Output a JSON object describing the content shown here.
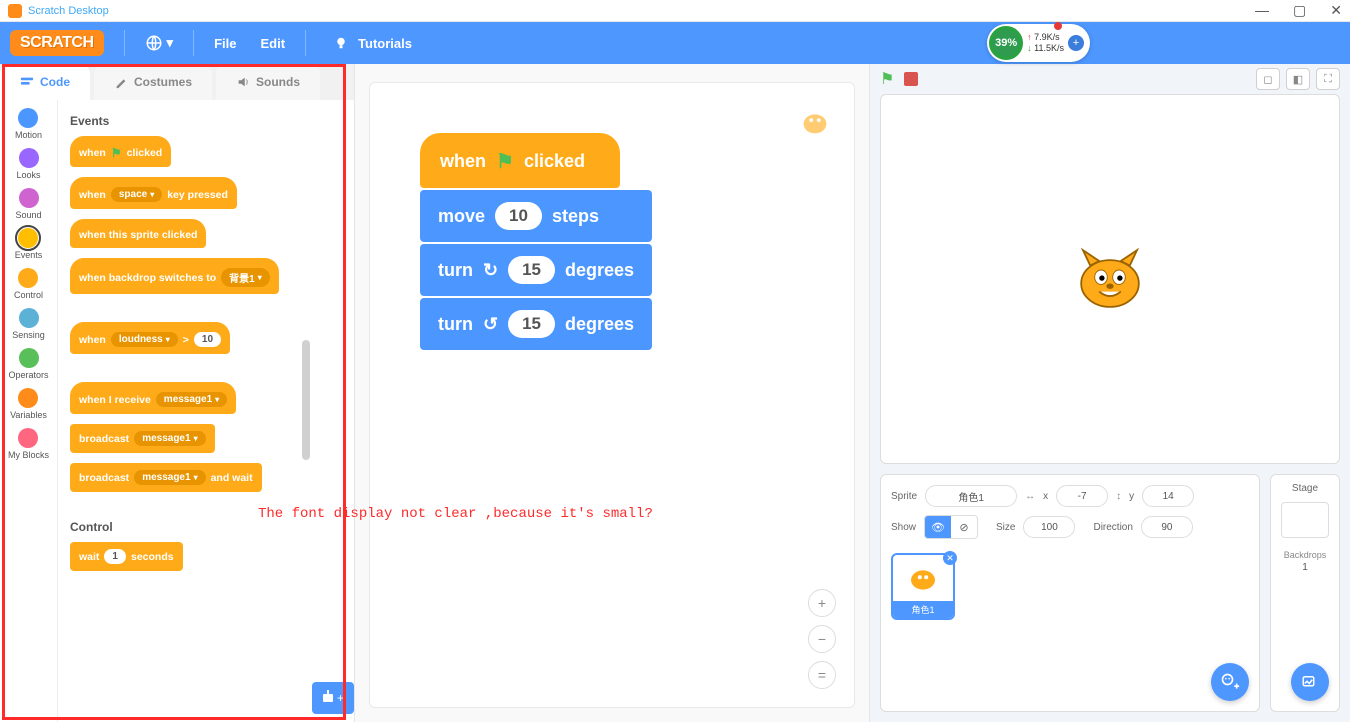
{
  "app": {
    "title": "Scratch Desktop"
  },
  "menubar": {
    "logo": "SCRATCH",
    "file": "File",
    "edit": "Edit",
    "tutorials": "Tutorials"
  },
  "net": {
    "percent": "39%",
    "up": "7.9K/s",
    "down": "11.5K/s"
  },
  "tabs": {
    "code": "Code",
    "costumes": "Costumes",
    "sounds": "Sounds"
  },
  "categories": [
    {
      "name": "Motion",
      "color": "#4c97ff"
    },
    {
      "name": "Looks",
      "color": "#9966ff"
    },
    {
      "name": "Sound",
      "color": "#cf63cf"
    },
    {
      "name": "Events",
      "color": "#ffbf00"
    },
    {
      "name": "Control",
      "color": "#ffab19"
    },
    {
      "name": "Sensing",
      "color": "#5cb1d6"
    },
    {
      "name": "Operators",
      "color": "#59c059"
    },
    {
      "name": "Variables",
      "color": "#ff8c1a"
    },
    {
      "name": "My Blocks",
      "color": "#ff6680"
    }
  ],
  "palette": {
    "events_label": "Events",
    "when_flag": "when",
    "clicked": "clicked",
    "when_key_a": "when",
    "space": "space",
    "key_pressed": "key pressed",
    "when_sprite": "when this sprite clicked",
    "when_backdrop_a": "when backdrop switches to",
    "backdrop_opt": "背景1",
    "when_loud_a": "when",
    "loudness": "loudness",
    "gt": ">",
    "ten": "10",
    "when_receive": "when I receive",
    "message1": "message1",
    "broadcast": "broadcast",
    "broadcast_wait_a": "broadcast",
    "and_wait": "and wait",
    "control_label": "Control",
    "wait_a": "wait",
    "one": "1",
    "seconds": "seconds"
  },
  "script": {
    "when": "when",
    "clicked": "clicked",
    "move": "move",
    "move_val": "10",
    "steps": "steps",
    "turn": "turn",
    "turn_val1": "15",
    "turn_val2": "15",
    "degrees": "degrees"
  },
  "annotation": "The font display not clear ,because it's small?",
  "spriteinfo": {
    "sprite_lbl": "Sprite",
    "name": "角色1",
    "x_lbl": "x",
    "x": "-7",
    "y_lbl": "y",
    "y": "14",
    "show_lbl": "Show",
    "size_lbl": "Size",
    "size": "100",
    "dir_lbl": "Direction",
    "dir": "90"
  },
  "stagepanel": {
    "label": "Stage",
    "backdrops_lbl": "Backdrops",
    "backdrops_count": "1"
  },
  "spritecard": {
    "name": "角色1"
  }
}
